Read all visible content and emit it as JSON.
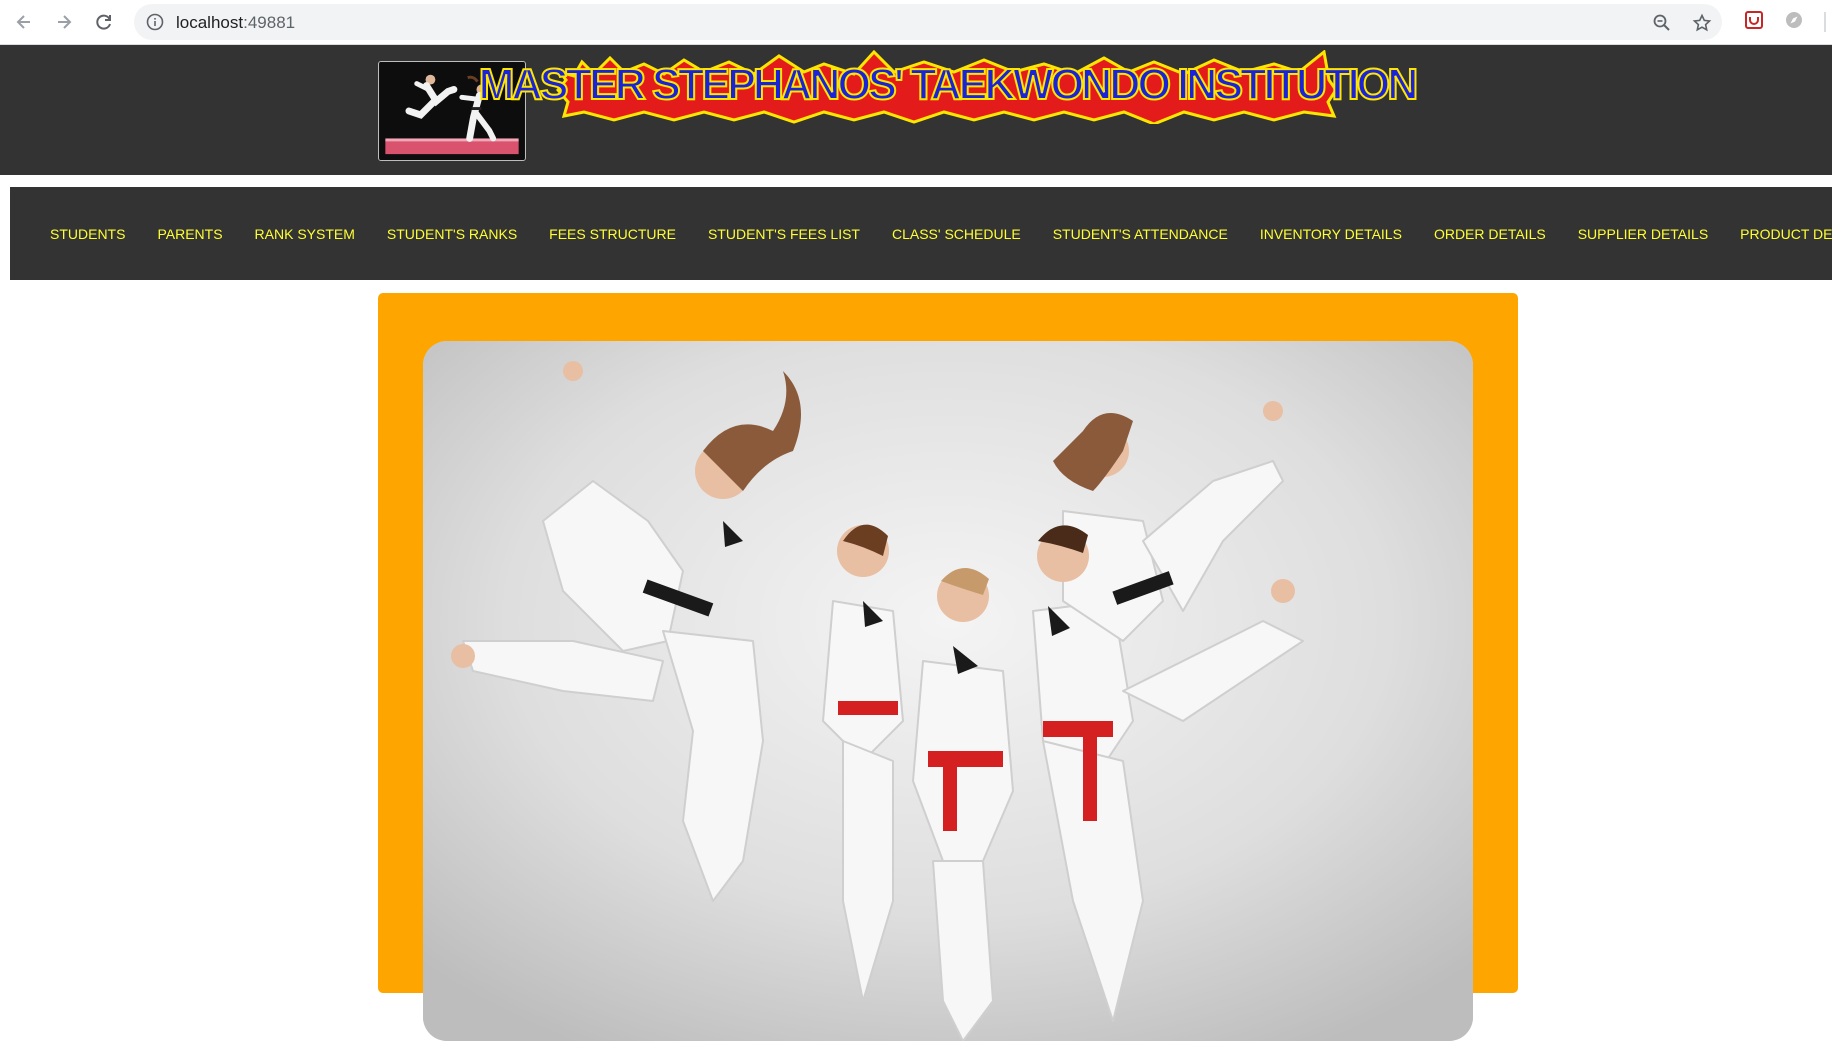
{
  "browser": {
    "url_host": "localhost",
    "url_port": ":49881",
    "icons": [
      "back-icon",
      "forward-icon",
      "reload-icon",
      "info-icon",
      "zoom-icon",
      "star-icon",
      "extension-icon",
      "compass-icon"
    ]
  },
  "header": {
    "title": "MASTER STEPHANOS' TAEKWONDO INSTITUTION",
    "title_color": "#1a24d6",
    "title_outline": "#ffe600",
    "title_burst": "#e41b1b",
    "background": "#333333"
  },
  "nav": {
    "items": [
      {
        "label": "STUDENTS"
      },
      {
        "label": "PARENTS"
      },
      {
        "label": "RANK SYSTEM"
      },
      {
        "label": "STUDENT'S RANKS"
      },
      {
        "label": "FEES STRUCTURE"
      },
      {
        "label": "STUDENT'S FEES LIST"
      },
      {
        "label": "CLASS' SCHEDULE"
      },
      {
        "label": "STUDENT'S ATTENDANCE"
      },
      {
        "label": "INVENTORY DETAILS"
      },
      {
        "label": "ORDER DETAILS"
      },
      {
        "label": "SUPPLIER DETAILS"
      },
      {
        "label": "PRODUCT DETAILS"
      }
    ],
    "link_color": "#ffff33"
  },
  "main": {
    "panel_color": "#ffa500",
    "hero_image": "taekwondo-students-kicking-photo"
  }
}
